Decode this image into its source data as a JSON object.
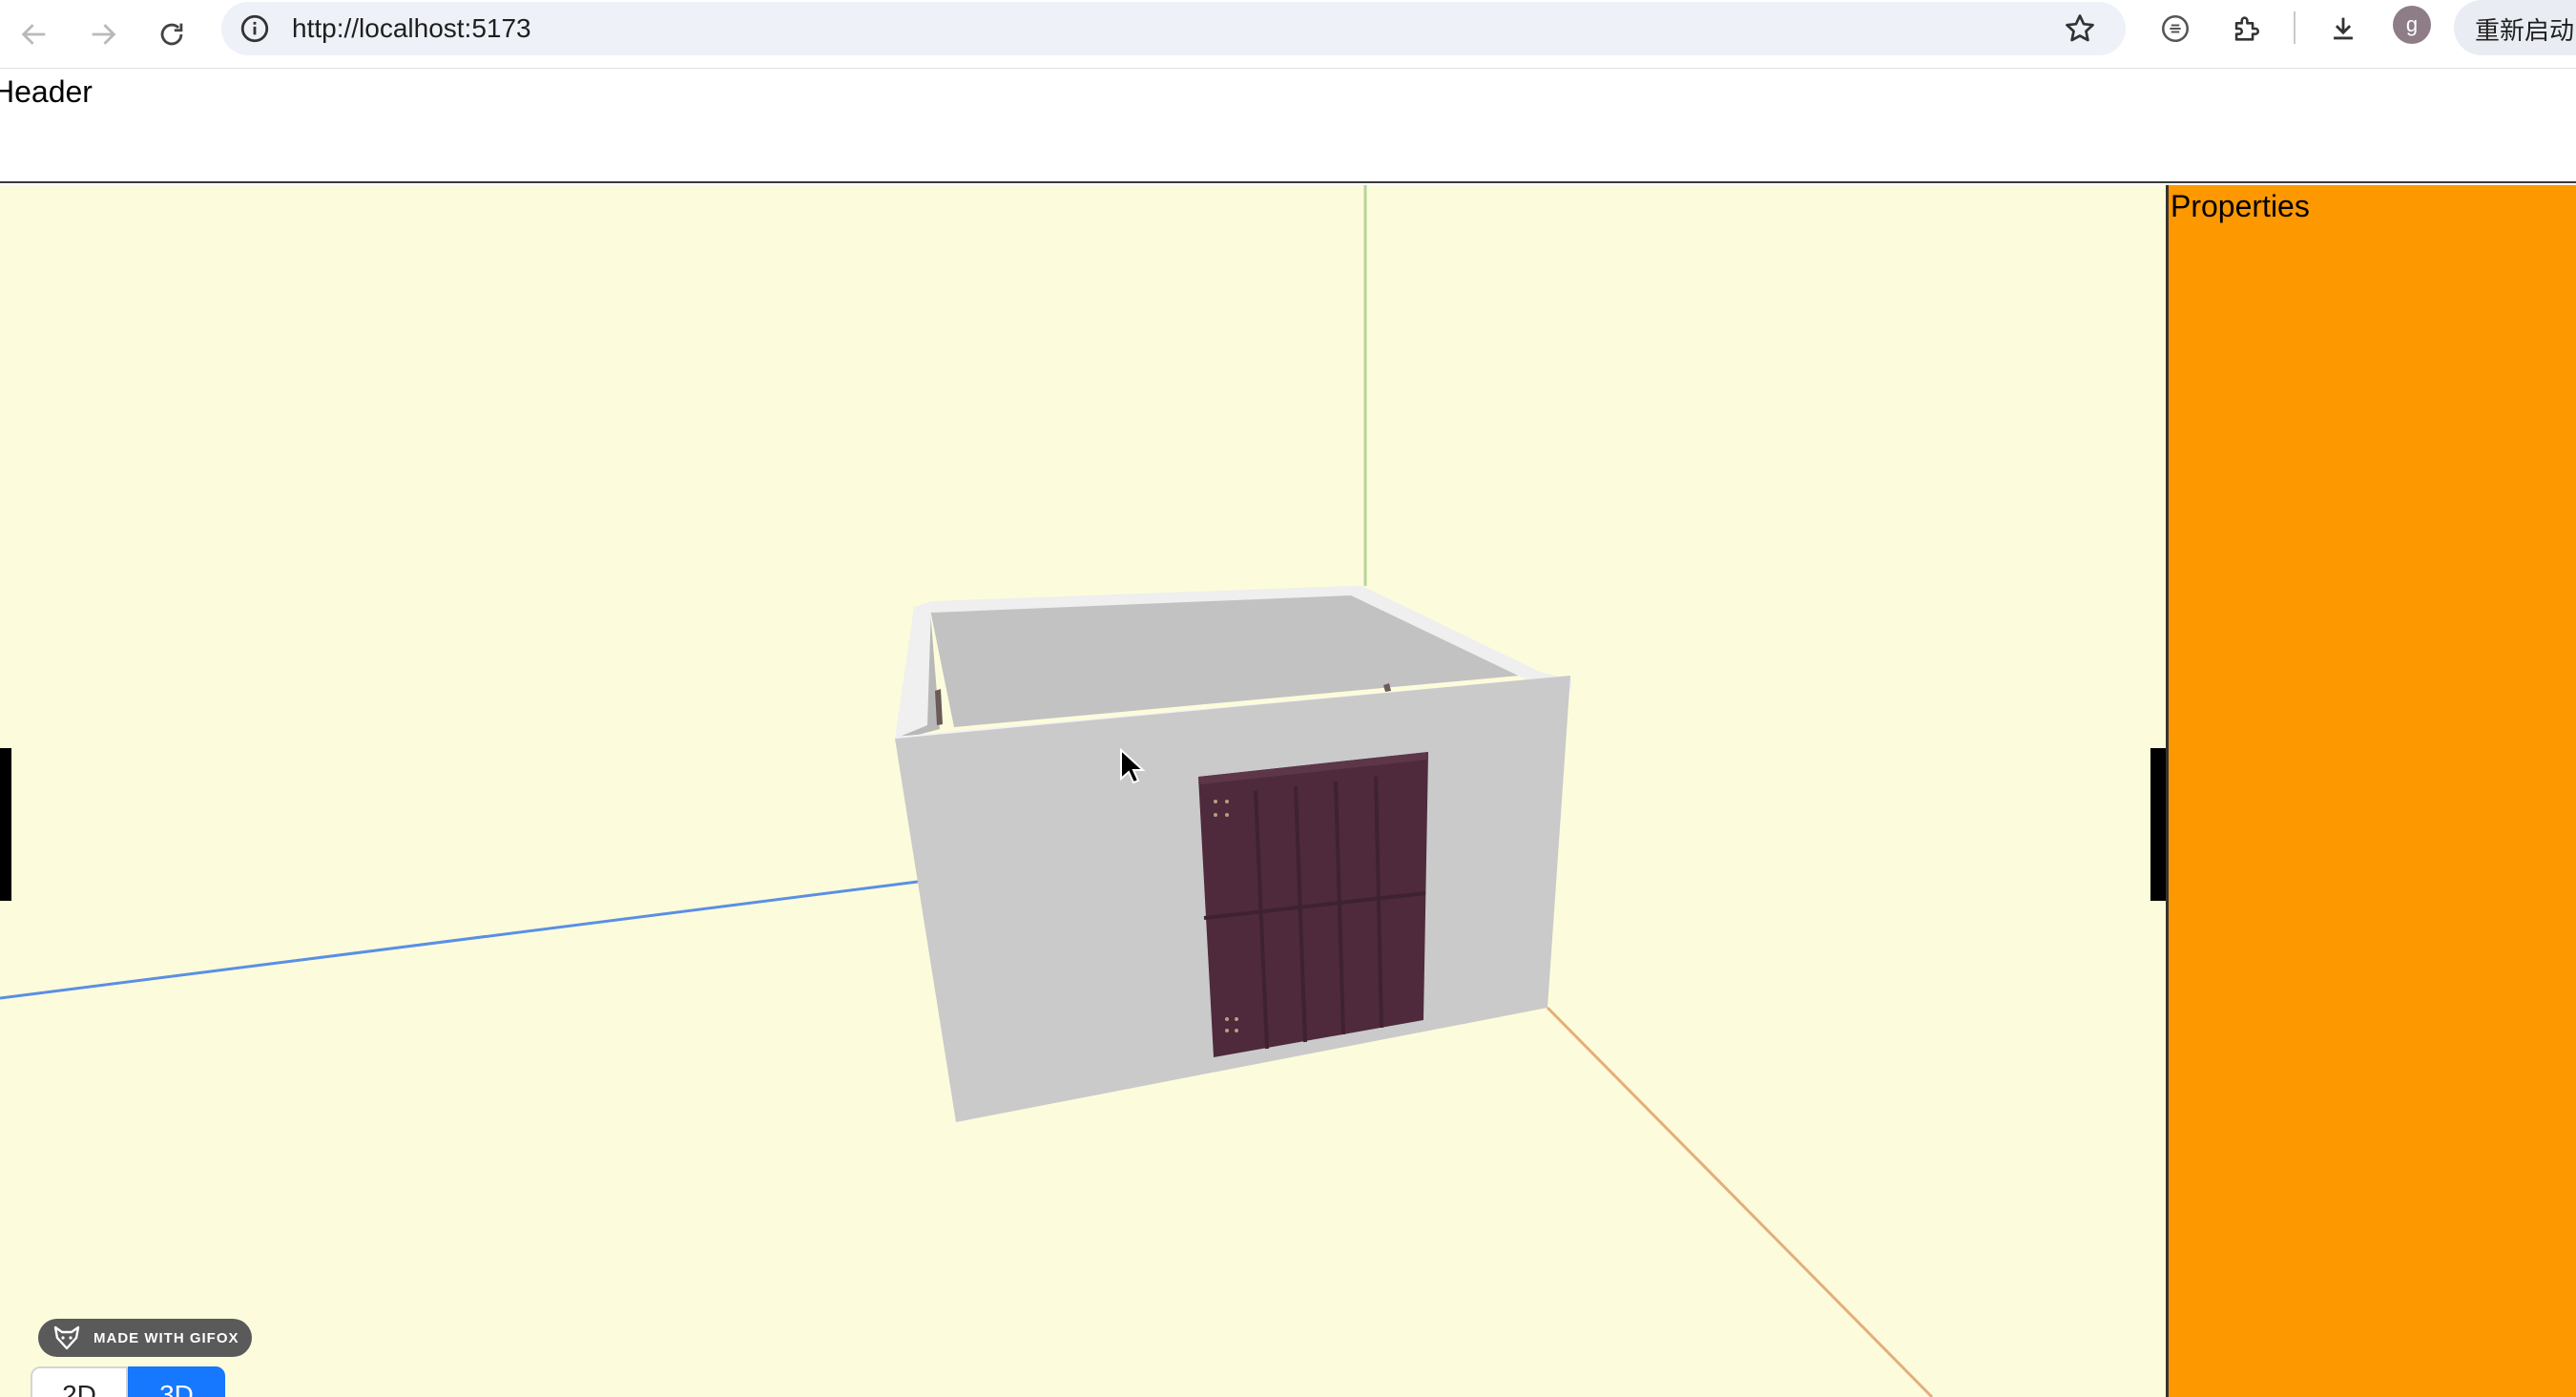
{
  "browser": {
    "url": "http://localhost:5173",
    "profile_initial": "g",
    "relaunch_label": "重新启动"
  },
  "app": {
    "header_title": "Header",
    "properties_title": "Properties",
    "view_toggle": {
      "options": [
        "2D",
        "3D"
      ],
      "selected": "3D"
    },
    "watermark": "MADE WITH GIFOX"
  },
  "icons": {
    "back": "arrow-left-icon",
    "forward": "arrow-right-icon",
    "reload": "reload-icon",
    "site_info": "info-icon",
    "bookmark": "star-icon",
    "extension_a": "extension-puzzle-icon",
    "download": "download-icon"
  },
  "colors": {
    "viewport_background": "#fcfcdc",
    "properties_background": "#fd9800",
    "wall": "#cacaca",
    "door": "#4e2a3c",
    "axis_x": "#5b8fe4",
    "axis_y": "#b9d49a",
    "axis_z": "#e6ad7a",
    "toggle_active": "#1677ff"
  }
}
